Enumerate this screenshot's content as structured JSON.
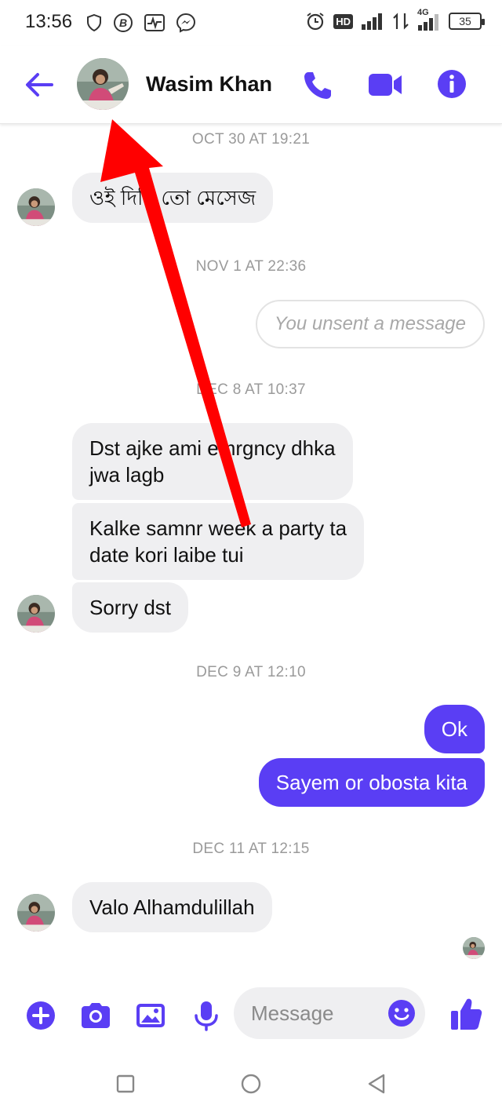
{
  "status_bar": {
    "time": "13:56",
    "network_label": "4G",
    "hd_label": "HD",
    "battery": "35"
  },
  "header": {
    "contact_name": "Wasim Khan",
    "accent_color": "#5a3ef4"
  },
  "messages": {
    "ts1": "OCT 30 AT 19:21",
    "m1": "ওই দিছি তো মেসেজ",
    "ts2": "NOV 1 AT 22:36",
    "unsent": "You unsent a message",
    "ts3": "DEC 8 AT 10:37",
    "m2_line1": "Dst ajke ami emrgncy dhka",
    "m2_line2": "jwa lagb",
    "m3_line1": "Kalke samnr week a party ta",
    "m3_line2": "date kori laibe tui",
    "m4": "Sorry dst",
    "ts4": "DEC 9 AT 12:10",
    "out1": "Ok",
    "out2": "Sayem or obosta kita",
    "ts5": "DEC 11 AT 12:15",
    "m5": "Valo Alhamdulillah"
  },
  "composer": {
    "placeholder": "Message"
  },
  "icons": {
    "back": "arrow-left-icon",
    "call": "phone-icon",
    "video": "video-camera-icon",
    "info": "info-icon",
    "add": "plus-circle-icon",
    "camera": "camera-icon",
    "gallery": "image-icon",
    "mic": "microphone-icon",
    "emoji": "smile-icon",
    "like": "thumbs-up-icon"
  },
  "annotation_color": "#ff0000"
}
